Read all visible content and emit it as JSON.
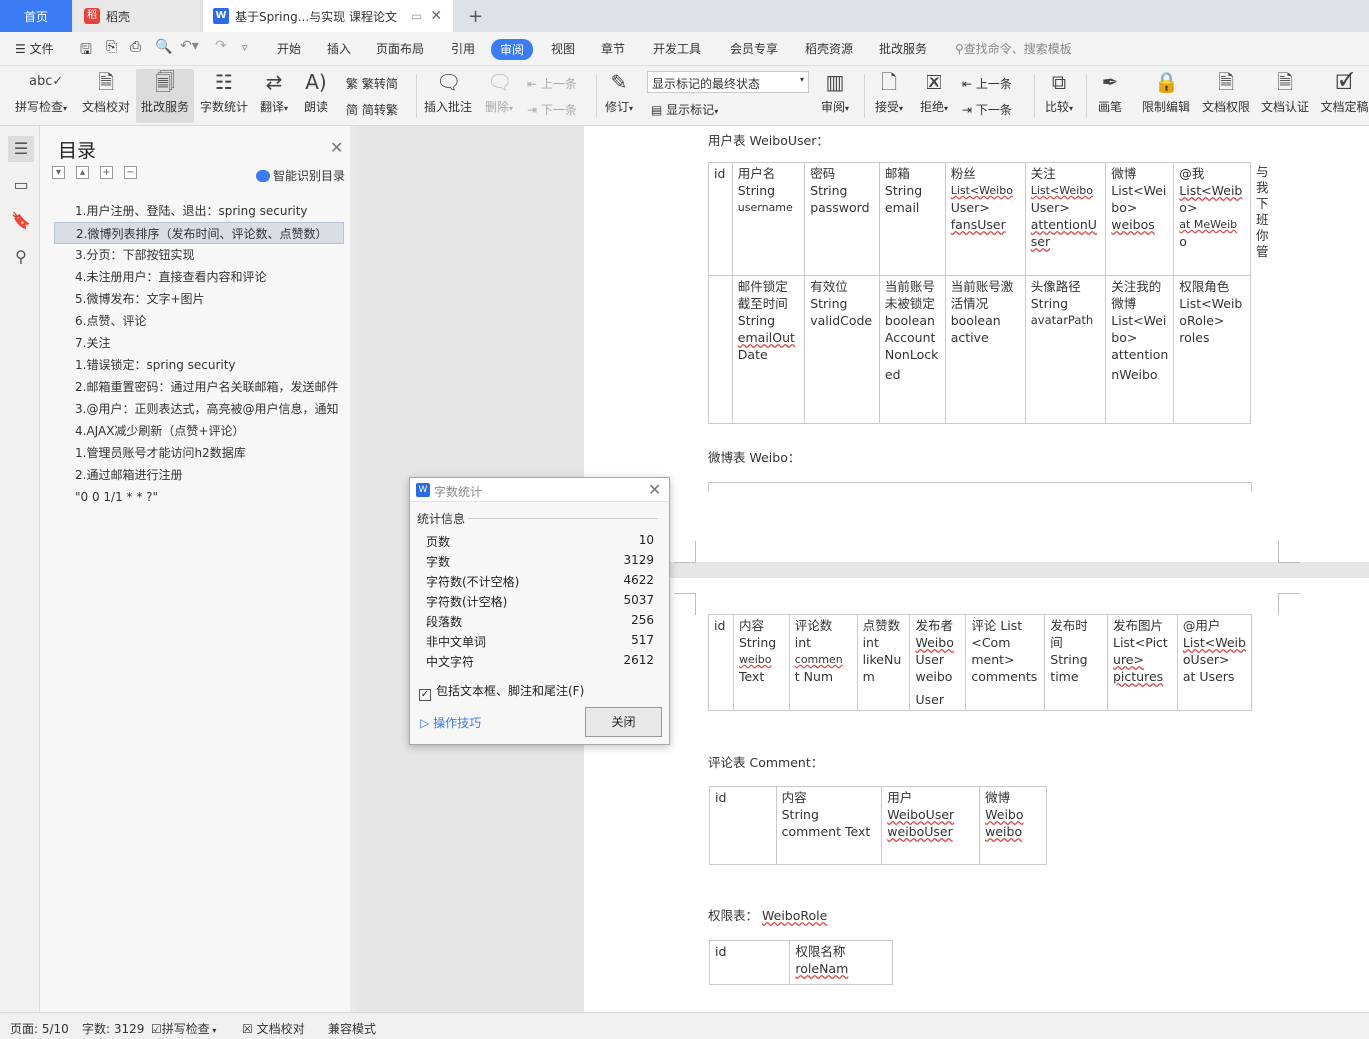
{
  "tabs": {
    "home": "首页",
    "daoke": "稻壳",
    "doc": "基于Spring...与实现 课程论文",
    "add": "+"
  },
  "menubar": {
    "file": "文件",
    "items": [
      "开始",
      "插入",
      "页面布局",
      "引用",
      "审阅",
      "视图",
      "章节",
      "开发工具",
      "会员专享",
      "稻壳资源",
      "批改服务"
    ],
    "active": "审阅",
    "search": "查找命令、搜索模板"
  },
  "ribbon": {
    "spellcheck": "拼写检查",
    "proofread": "文档校对",
    "review_service": "批改服务",
    "wordcount": "字数统计",
    "translate": "翻译",
    "read": "朗读",
    "trad": "繁转简",
    "simp": "简转繁",
    "insert_comment": "插入批注",
    "delete": "删除",
    "prev": "上一条",
    "next": "下一条",
    "track": "修订",
    "markup_state": "显示标记的最终状态",
    "show_markup": "显示标记",
    "review": "审阅",
    "accept": "接受",
    "reject": "拒绝",
    "prev2": "上一条",
    "next2": "下一条",
    "compare": "比较",
    "pen": "画笔",
    "restrict": "限制编辑",
    "permission": "文档权限",
    "certify": "文档认证",
    "finalize": "文档定稿"
  },
  "nav": {
    "title": "目录",
    "smart": "智能识别目录",
    "items": [
      "1.用户注册、登陆、退出：spring security",
      "2.微博列表排序（发布时间、评论数、点赞数）",
      "3.分页：下部按钮实现",
      "4.未注册用户：直接查看内容和评论",
      "5.微博发布：文字+图片",
      "6.点赞、评论",
      "7.关注",
      "1.错误锁定：spring security",
      "2.邮箱重置密码：通过用户名关联邮箱，发送邮件",
      "3.@用户：正则表达式，高亮被@用户信息，通知",
      "4.AJAX减少刷新（点赞+评论）",
      "1.管理员账号才能访问h2数据库",
      "2.通过邮箱进行注册",
      "\"0 0 1/1 * * ?\""
    ],
    "selected": 1
  },
  "doc": {
    "user_caption": "用户表 WeiboUser：",
    "weibo_caption": "微博表 Weibo：",
    "comment_caption": "评论表 Comment：",
    "role_caption_a": "权限表：",
    "role_caption_b": "WeiboRole",
    "user_row1": [
      [
        "id"
      ],
      [
        "用户名",
        "String",
        "username"
      ],
      [
        "密码",
        "String",
        "password"
      ],
      [
        "邮箱",
        "String",
        "email"
      ],
      [
        "粉丝",
        "List<Weibo",
        "User>",
        "fansUser"
      ],
      [
        "关注",
        "List<Weibo",
        "User>",
        "attentionU",
        "ser"
      ],
      [
        "微博",
        "List<Wei",
        "bo>",
        "weibos"
      ],
      [
        "@我",
        "List<Weib",
        "o>",
        "at MeWeib",
        "o"
      ]
    ],
    "user_side": [
      "与",
      "我",
      "下",
      "班",
      "你",
      "管"
    ],
    "user_row2": [
      [
        ""
      ],
      [
        "邮件锁定",
        "截至时间",
        "String",
        "emailOut",
        "Date"
      ],
      [
        "有效位",
        "String",
        "validCode"
      ],
      [
        "当前账号",
        "未被锁定",
        "boolean",
        "Account",
        "NonLock",
        "ed"
      ],
      [
        "当前账号激",
        "活情况",
        "boolean",
        "active"
      ],
      [
        "头像路径",
        "String",
        "avatarPath"
      ],
      [
        "关注我的",
        "微博",
        "List<Wei",
        "bo>",
        "attention",
        "nWeibo"
      ],
      [
        "权限角色",
        "List<Weib",
        "oRole>",
        "roles"
      ]
    ],
    "weibo_row": [
      [
        "id"
      ],
      [
        "内容",
        "String",
        "weibo",
        "Text"
      ],
      [
        "评论数",
        "int",
        "commen",
        "t Num"
      ],
      [
        "点赞数",
        "int",
        "likeNu",
        "m"
      ],
      [
        "发布者",
        "Weibo",
        "User",
        "weibo",
        "User"
      ],
      [
        "评论 List",
        "<Com",
        "ment>",
        "comments"
      ],
      [
        "发布时",
        "间",
        "String",
        "time"
      ],
      [
        "发布图片",
        "List<Pict",
        "ure>",
        "pictures"
      ],
      [
        "@用户",
        "List<Weib",
        "oUser>",
        "at Users"
      ]
    ],
    "comment_row": [
      [
        "id"
      ],
      [
        "内容",
        "String",
        "comment Text"
      ],
      [
        "用户",
        "WeiboUser",
        "weiboUser"
      ],
      [
        "微博",
        "Weibo",
        "weibo"
      ]
    ],
    "role_row": [
      [
        "id"
      ],
      [
        "权限名称",
        "roleNam"
      ]
    ]
  },
  "dialog": {
    "title": "字数统计",
    "section": "统计信息",
    "rows": [
      {
        "label": "页数",
        "value": "10"
      },
      {
        "label": "字数",
        "value": "3129"
      },
      {
        "label": "字符数(不计空格)",
        "value": "4622"
      },
      {
        "label": "字符数(计空格)",
        "value": "5037"
      },
      {
        "label": "段落数",
        "value": "256"
      },
      {
        "label": "非中文单词",
        "value": "517"
      },
      {
        "label": "中文字符",
        "value": "2612"
      }
    ],
    "checkbox": "包括文本框、脚注和尾注(F)",
    "checked": true,
    "tips": "操作技巧",
    "close": "关闭"
  },
  "status": {
    "page": "页面: 5/10",
    "words": "字数: 3129",
    "spell": "拼写检查",
    "proof": "文档校对",
    "mode": "兼容模式"
  },
  "colors": {
    "accent": "#3b7cf4",
    "brand_red": "#e8413c"
  }
}
